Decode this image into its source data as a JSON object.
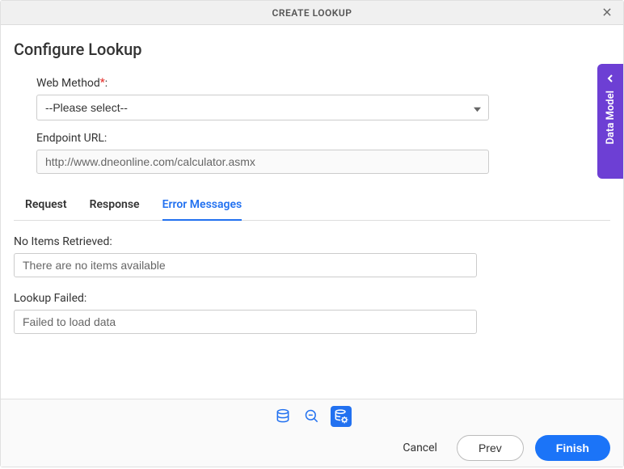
{
  "header": {
    "title": "CREATE LOOKUP"
  },
  "page": {
    "title": "Configure Lookup"
  },
  "form": {
    "web_method_label": "Web Method",
    "web_method_suffix": ":",
    "web_method_placeholder": "--Please select--",
    "endpoint_label": "Endpoint URL:",
    "endpoint_value": "http://www.dneonline.com/calculator.asmx"
  },
  "tabs": {
    "request": "Request",
    "response": "Response",
    "error_messages": "Error Messages"
  },
  "messages": {
    "no_items_label": "No Items Retrieved:",
    "no_items_value": "There are no items available",
    "lookup_failed_label": "Lookup Failed:",
    "lookup_failed_value": "Failed to load data"
  },
  "side_panel": {
    "label": "Data Model"
  },
  "footer": {
    "cancel": "Cancel",
    "prev": "Prev",
    "finish": "Finish"
  }
}
